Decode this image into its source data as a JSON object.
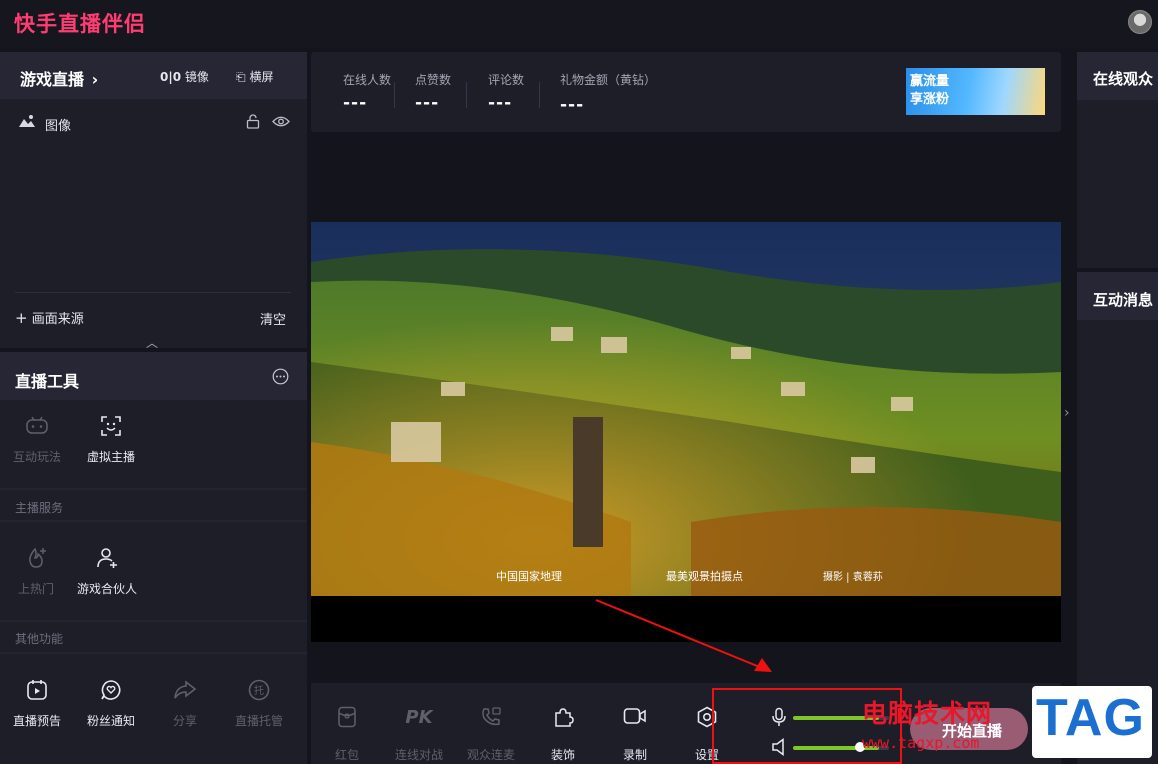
{
  "app": {
    "title": "快手直播伴侣"
  },
  "source_panel": {
    "mode_title": "游戏直播",
    "mirror_label": "镜像",
    "landscape_label": "横屏",
    "layers": [
      {
        "label": "图像"
      }
    ],
    "add_source_label": "画面来源",
    "clear_label": "清空"
  },
  "tools_panel": {
    "title": "直播工具",
    "items": [
      {
        "label": "互动玩法",
        "icon": "gamepad-icon",
        "enabled": false
      },
      {
        "label": "虚拟主播",
        "icon": "face-scan-icon",
        "enabled": true
      }
    ],
    "section_anchor": "主播服务",
    "anchor_items": [
      {
        "label": "上热门",
        "icon": "fire-plus-icon",
        "enabled": false
      },
      {
        "label": "游戏合伙人",
        "icon": "user-plus-icon",
        "enabled": true
      }
    ],
    "section_other": "其他功能",
    "other_items": [
      {
        "label": "直播预告",
        "icon": "calendar-play-icon",
        "enabled": true
      },
      {
        "label": "粉丝通知",
        "icon": "heart-chat-icon",
        "enabled": true
      },
      {
        "label": "分享",
        "icon": "share-icon",
        "enabled": false
      },
      {
        "label": "直播托管",
        "icon": "hosting-icon",
        "enabled": false
      }
    ]
  },
  "stats": [
    {
      "label": "在线人数",
      "value": "---"
    },
    {
      "label": "点赞数",
      "value": "---"
    },
    {
      "label": "评论数",
      "value": "---"
    },
    {
      "label": "礼物金额（黄钻）",
      "value": "---"
    }
  ],
  "banner": {
    "line1": "赢流量",
    "line2": "享涨粉"
  },
  "preview": {
    "credit_left": "中国国家地理",
    "credit_mid": "最美观景拍摄点",
    "credit_right": "摄影 | 袁蓉荪"
  },
  "bottom_tools": [
    {
      "label": "红包",
      "icon": "red-packet-icon",
      "enabled": false
    },
    {
      "label": "连线对战",
      "icon": "pk-icon",
      "enabled": false
    },
    {
      "label": "观众连麦",
      "icon": "phone-link-icon",
      "enabled": false
    },
    {
      "label": "装饰",
      "icon": "puzzle-icon",
      "enabled": true
    },
    {
      "label": "录制",
      "icon": "video-camera-icon",
      "enabled": true
    },
    {
      "label": "设置",
      "icon": "settings-icon",
      "enabled": true
    }
  ],
  "audio": {
    "mic_level": 0.9,
    "speaker_level": 0.9
  },
  "start_button": {
    "label": "开始直播"
  },
  "right_panels": {
    "viewers_title": "在线观众",
    "messages_title": "互动消息"
  },
  "watermark": {
    "site": "电脑技术网",
    "url": "www.tagxp.com",
    "tag": "TAG"
  },
  "colors": {
    "brand": "#ff3d72",
    "panel": "#1e1e29",
    "level": "#7ec629",
    "annotation": "#ee1111"
  }
}
